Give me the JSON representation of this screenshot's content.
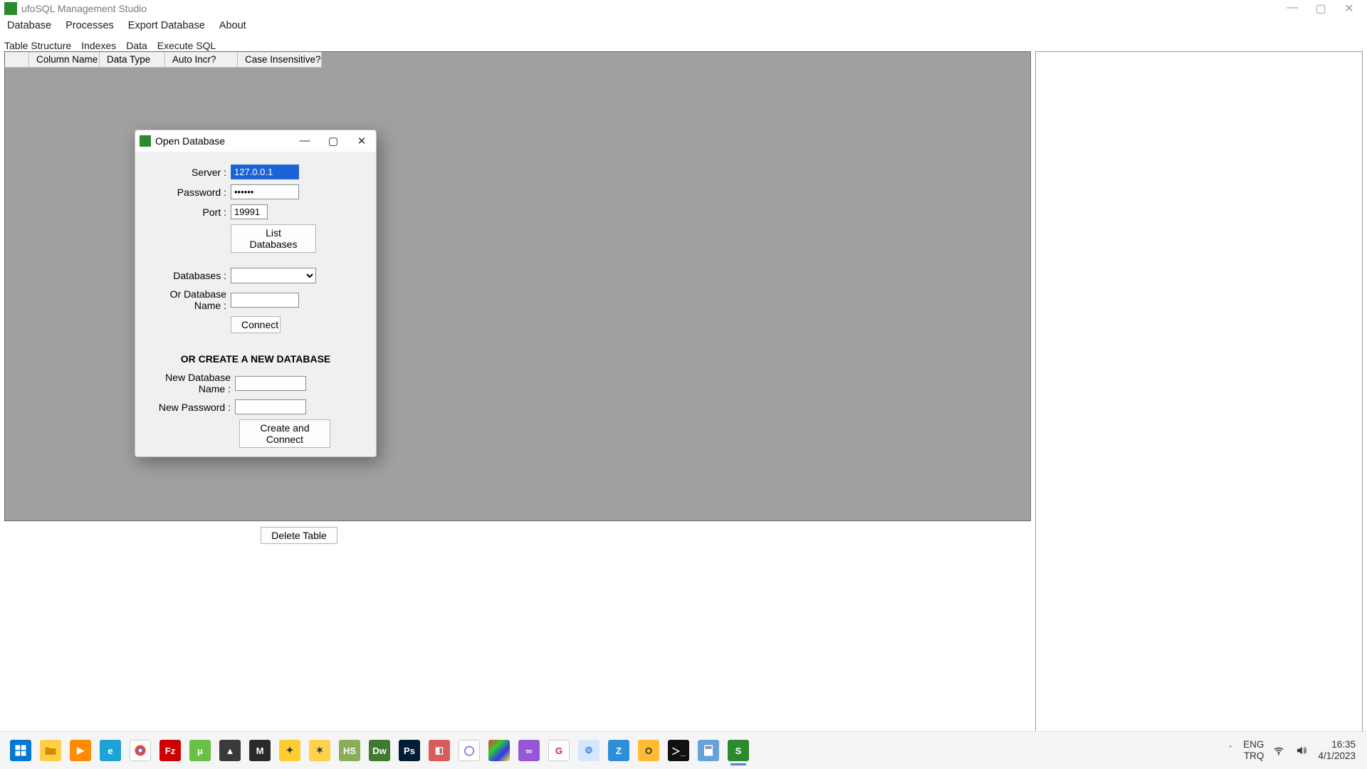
{
  "window": {
    "title": "ufoSQL Management Studio"
  },
  "menu": {
    "database": "Database",
    "processes": "Processes",
    "export": "Export Database",
    "about": "About"
  },
  "tabs": {
    "structure": "Table Structure",
    "indexes": "Indexes",
    "data": "Data",
    "execute": "Execute SQL"
  },
  "grid": {
    "columns": {
      "colname": "Column Name",
      "datatype": "Data Type",
      "autoincr": "Auto Incr?",
      "caseins": "Case Insensitive?"
    }
  },
  "buttons": {
    "delete_table": "Delete Table"
  },
  "dialog": {
    "title": "Open Database",
    "labels": {
      "server": "Server :",
      "password": "Password :",
      "port": "Port :",
      "databases": "Databases :",
      "or_dbname": "Or Database Name :",
      "section": "OR CREATE A NEW DATABASE",
      "new_dbname": "New Database Name :",
      "new_password": "New Password :"
    },
    "values": {
      "server": "127.0.0.1",
      "password": "••••••",
      "port": "19991",
      "database_selected": "",
      "or_dbname": "",
      "new_dbname": "",
      "new_password": ""
    },
    "buttons": {
      "list": "List Databases",
      "connect": "Connect",
      "create": "Create and Connect"
    }
  },
  "tray": {
    "lang1": "ENG",
    "lang2": "TRQ",
    "time": "16:35",
    "date": "4/1/2023"
  }
}
